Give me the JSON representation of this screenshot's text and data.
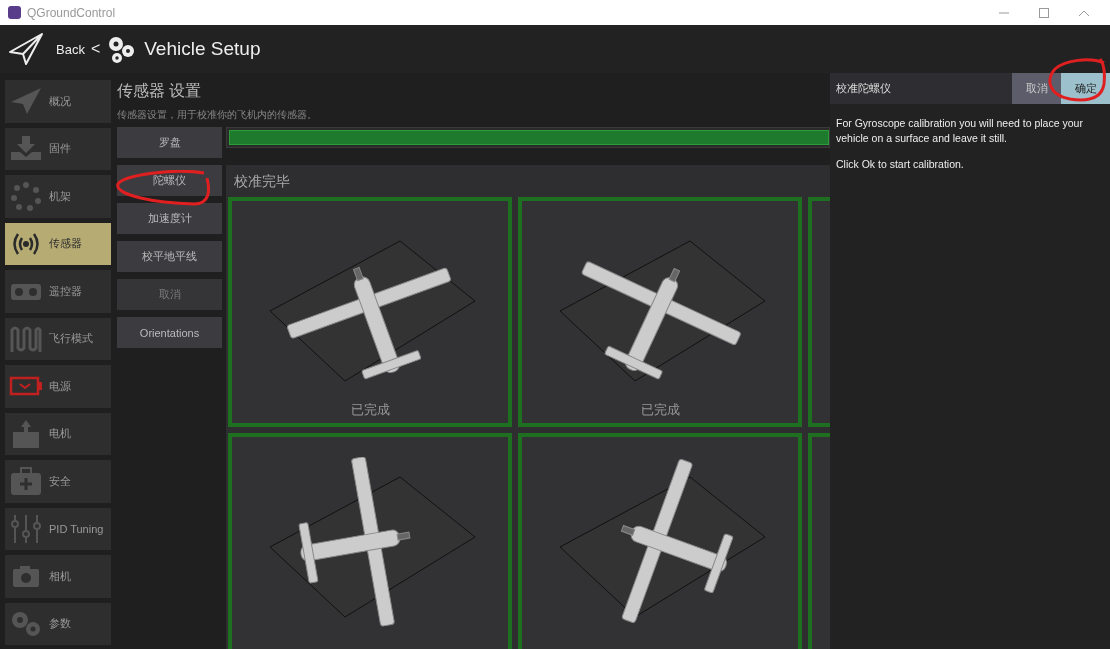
{
  "window": {
    "title": "QGroundControl"
  },
  "header": {
    "back": "Back",
    "separator": "<",
    "title": "Vehicle Setup"
  },
  "sidebar": {
    "items": [
      {
        "label": "概况",
        "selected": false
      },
      {
        "label": "固件",
        "selected": false
      },
      {
        "label": "机架",
        "selected": false
      },
      {
        "label": "传感器",
        "selected": true
      },
      {
        "label": "遥控器",
        "selected": false
      },
      {
        "label": "飞行模式",
        "selected": false
      },
      {
        "label": "电源",
        "selected": false
      },
      {
        "label": "电机",
        "selected": false
      },
      {
        "label": "安全",
        "selected": false
      },
      {
        "label": "PID Tuning",
        "selected": false
      },
      {
        "label": "相机",
        "selected": false
      },
      {
        "label": "参数",
        "selected": false
      }
    ]
  },
  "sensors": {
    "title": "传感器 设置",
    "subtitle": "传感器设置，用于校准你的飞机内的传感器。",
    "buttons": [
      {
        "label": "罗盘",
        "disabled": false
      },
      {
        "label": "陀螺仪",
        "disabled": false
      },
      {
        "label": "加速度计",
        "disabled": false
      },
      {
        "label": "校平地平线",
        "disabled": false
      },
      {
        "label": "取消",
        "disabled": true
      },
      {
        "label": "Orientations",
        "disabled": false
      }
    ],
    "progress": {
      "level": 1
    },
    "calibration": {
      "heading": "校准完毕",
      "cells": [
        {
          "label": "已完成",
          "done": true
        },
        {
          "label": "已完成",
          "done": true
        },
        {
          "done": true
        },
        {
          "done": true
        },
        {
          "done": true
        },
        {
          "done": true
        }
      ]
    }
  },
  "dialog": {
    "title": "校准陀螺仪",
    "buttons": [
      {
        "label": "取消",
        "primary": false
      },
      {
        "label": "确定",
        "primary": true
      }
    ],
    "paragraphs": [
      "For Gyroscope calibration you will need to place your vehicle on a surface and leave it still.",
      "Click Ok to start calibration."
    ]
  }
}
